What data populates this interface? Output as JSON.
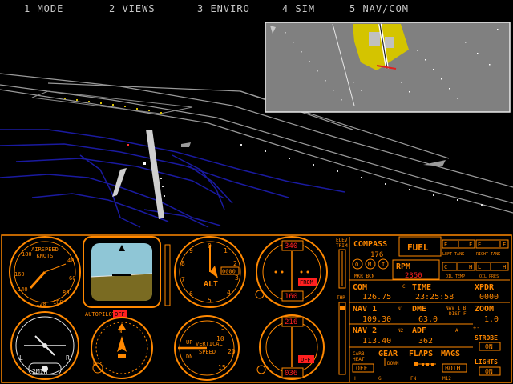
{
  "menu": [
    {
      "label": "1 MODE"
    },
    {
      "label": "2 VIEWS"
    },
    {
      "label": "3 ENVIRO"
    },
    {
      "label": "4 SIM"
    },
    {
      "label": "5 NAV/COM"
    }
  ],
  "colors": {
    "instrument_orange": "#ff8800",
    "panel_bg": "#000000",
    "sky_blue": "#8fc6d6",
    "ground_olive": "#7a6b22",
    "red_value": "#ff2020",
    "gauge_white": "#e8e8e8",
    "runway_yellow": "#d4c400",
    "map_gray": "#808080"
  },
  "airspeed": {
    "title1": "AIRSPEED",
    "title2": "KNOTS",
    "t1": "180",
    "t2": "40",
    "t3": "60",
    "t4": "80",
    "t5": "160",
    "t6": "140",
    "t7": "120",
    "t8": "100"
  },
  "attitude": {},
  "altimeter": {
    "label": "ALT",
    "box": "0000",
    "t0": "0",
    "t1": "1",
    "t2": "2",
    "t3": "3",
    "t4": "4",
    "t5": "5",
    "t6": "6",
    "t7": "7",
    "t8": "8",
    "t9": "9"
  },
  "vor1": {
    "top": "340",
    "flag": "FROM",
    "bottom": "160"
  },
  "vor2": {
    "top": "216",
    "flag": "OFF",
    "bottom": "036"
  },
  "turn": {
    "label": "2MIN",
    "l": "L",
    "r": "R"
  },
  "autopilot": {
    "label": "AUTOPILOT",
    "state": "OFF"
  },
  "heading": {
    "d": "D",
    "n": "N"
  },
  "vsi": {
    "up": "UP",
    "l1": "VERTICAL",
    "l2": "SPEED",
    "dn": "DN",
    "t5": "5",
    "t10": "10",
    "t15": "15",
    "t20": "20"
  },
  "trim": {
    "label1": "ELEV",
    "label2": "TRIM",
    "thr": "THR"
  },
  "compass": {
    "label": "COMPASS",
    "value": "176"
  },
  "fuel": {
    "label": "FUEL",
    "left_e": "E",
    "left_f": "F",
    "right_e": "E",
    "right_f": "F",
    "left_tank": "LEFT TANK",
    "right_tank": "RIGHT TANK",
    "oil_c": "C",
    "oil_h": "H",
    "oil_l": "L",
    "oil_hh": "H",
    "oil_temp": "OIL TEMP",
    "oil_pres": "OIL PRES"
  },
  "marker": {
    "o": "O",
    "m": "M",
    "i": "I",
    "label": "MKR BCN"
  },
  "rpm": {
    "label": "RPM",
    "value": "2350"
  },
  "com": {
    "label": "COM",
    "sub": "C",
    "value": "126.75"
  },
  "time": {
    "label": "TIME",
    "value": "23:25:58"
  },
  "xpdr": {
    "label": "XPDR",
    "value": "0000"
  },
  "nav1": {
    "label": "NAV 1",
    "sub": "N1",
    "value": "109.30"
  },
  "dme": {
    "label": "DME",
    "value": "63.0",
    "note1": "NAV 1 B",
    "note2": "DIST F"
  },
  "zoom": {
    "label": "ZOOM",
    "value": "1.0",
    "pm": "+-"
  },
  "nav2": {
    "label": "NAV 2",
    "sub": "N2",
    "value": "113.40"
  },
  "adf": {
    "label": "ADF",
    "sub": "A",
    "value": "362"
  },
  "strobe": {
    "label": "STROBE",
    "value": "ON"
  },
  "carb": {
    "label1": "CARB",
    "label2": "HEAT",
    "value": "OFF",
    "key": "H"
  },
  "gear": {
    "label": "GEAR",
    "value": "DOWN",
    "key": "G"
  },
  "flaps": {
    "label": "FLAPS",
    "key": "FN"
  },
  "mags": {
    "label": "MAGS",
    "value": "BOTH",
    "key": "M12"
  },
  "lights": {
    "label": "LIGHTS",
    "value": "ON"
  }
}
